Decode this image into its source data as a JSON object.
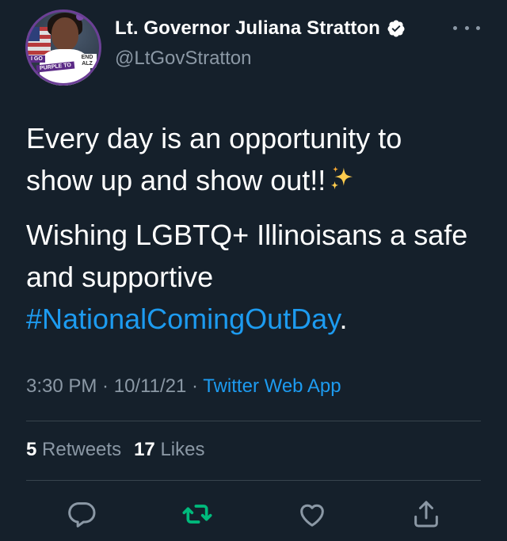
{
  "author": {
    "display_name": "Lt. Governor Juliana Stratton",
    "handle": "@LtGovStratton",
    "avatar_badge": {
      "go": "I GO",
      "purple": "PURPLE TO",
      "end": "END ALZ"
    }
  },
  "tweet": {
    "line1": "Every day is an opportunity to show up and show out!!",
    "line2_prefix": "Wishing LGBTQ+ Illinoisans a safe and supportive",
    "hashtag": "#NationalComingOutDay",
    "line2_suffix": "."
  },
  "meta": {
    "time": "3:30 PM",
    "sep1": " · ",
    "date": "10/11/21",
    "sep2": " · ",
    "source": "Twitter Web App"
  },
  "stats": {
    "retweets_count": "5",
    "retweets_label": "Retweets",
    "likes_count": "17",
    "likes_label": "Likes"
  },
  "colors": {
    "background": "#15202b",
    "accent": "#1d9bf0",
    "muted": "#8b98a5",
    "retweeted": "#00ba7c"
  },
  "icons": {
    "verified": "verified-badge-icon",
    "more": "more-dots-icon",
    "reply": "reply-icon",
    "retweet": "retweet-icon",
    "like": "heart-icon",
    "share": "share-icon",
    "sparkles": "sparkles-icon"
  }
}
